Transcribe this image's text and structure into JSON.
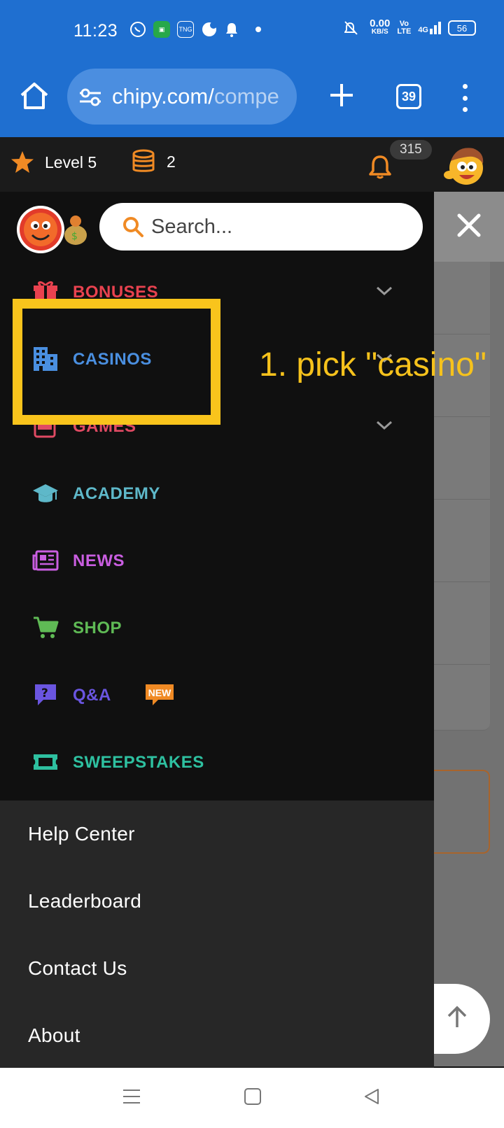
{
  "status_bar": {
    "time": "11:23",
    "net_speed_top": "0.00",
    "net_speed_unit": "KB/S",
    "volte_top": "Vo",
    "volte_bottom": "LTE",
    "network": "4G",
    "battery": "56"
  },
  "browser": {
    "url_main": "chipy.com/",
    "url_dim": "compe",
    "tab_count": "39"
  },
  "site_header": {
    "level_label": "Level 5",
    "coin_count": "2",
    "notification_count": "315"
  },
  "drawer": {
    "search_placeholder": "Search...",
    "menu_items": [
      {
        "label": "BONUSES",
        "color": "#e9424f"
      },
      {
        "label": "CASINOS",
        "color": "#4a8fe0"
      },
      {
        "label": "GAMES",
        "color": "#e04a63"
      },
      {
        "label": "ACADEMY",
        "color": "#5eb8c9"
      },
      {
        "label": "NEWS",
        "color": "#c95ee0"
      },
      {
        "label": "SHOP",
        "color": "#5fba55"
      },
      {
        "label": "Q&A",
        "color": "#6a55e0"
      },
      {
        "label": "SWEEPSTAKES",
        "color": "#2ec0a0"
      }
    ],
    "new_badge": "NEW",
    "footer_items": [
      "Help Center",
      "Leaderboard",
      "Contact Us",
      "About"
    ]
  },
  "annotation": {
    "text": "1.  pick \"casino\""
  },
  "colors": {
    "chrome_blue": "#1f6fd0",
    "highlight_yellow": "#f9c41c",
    "accent_orange": "#f08a24"
  }
}
